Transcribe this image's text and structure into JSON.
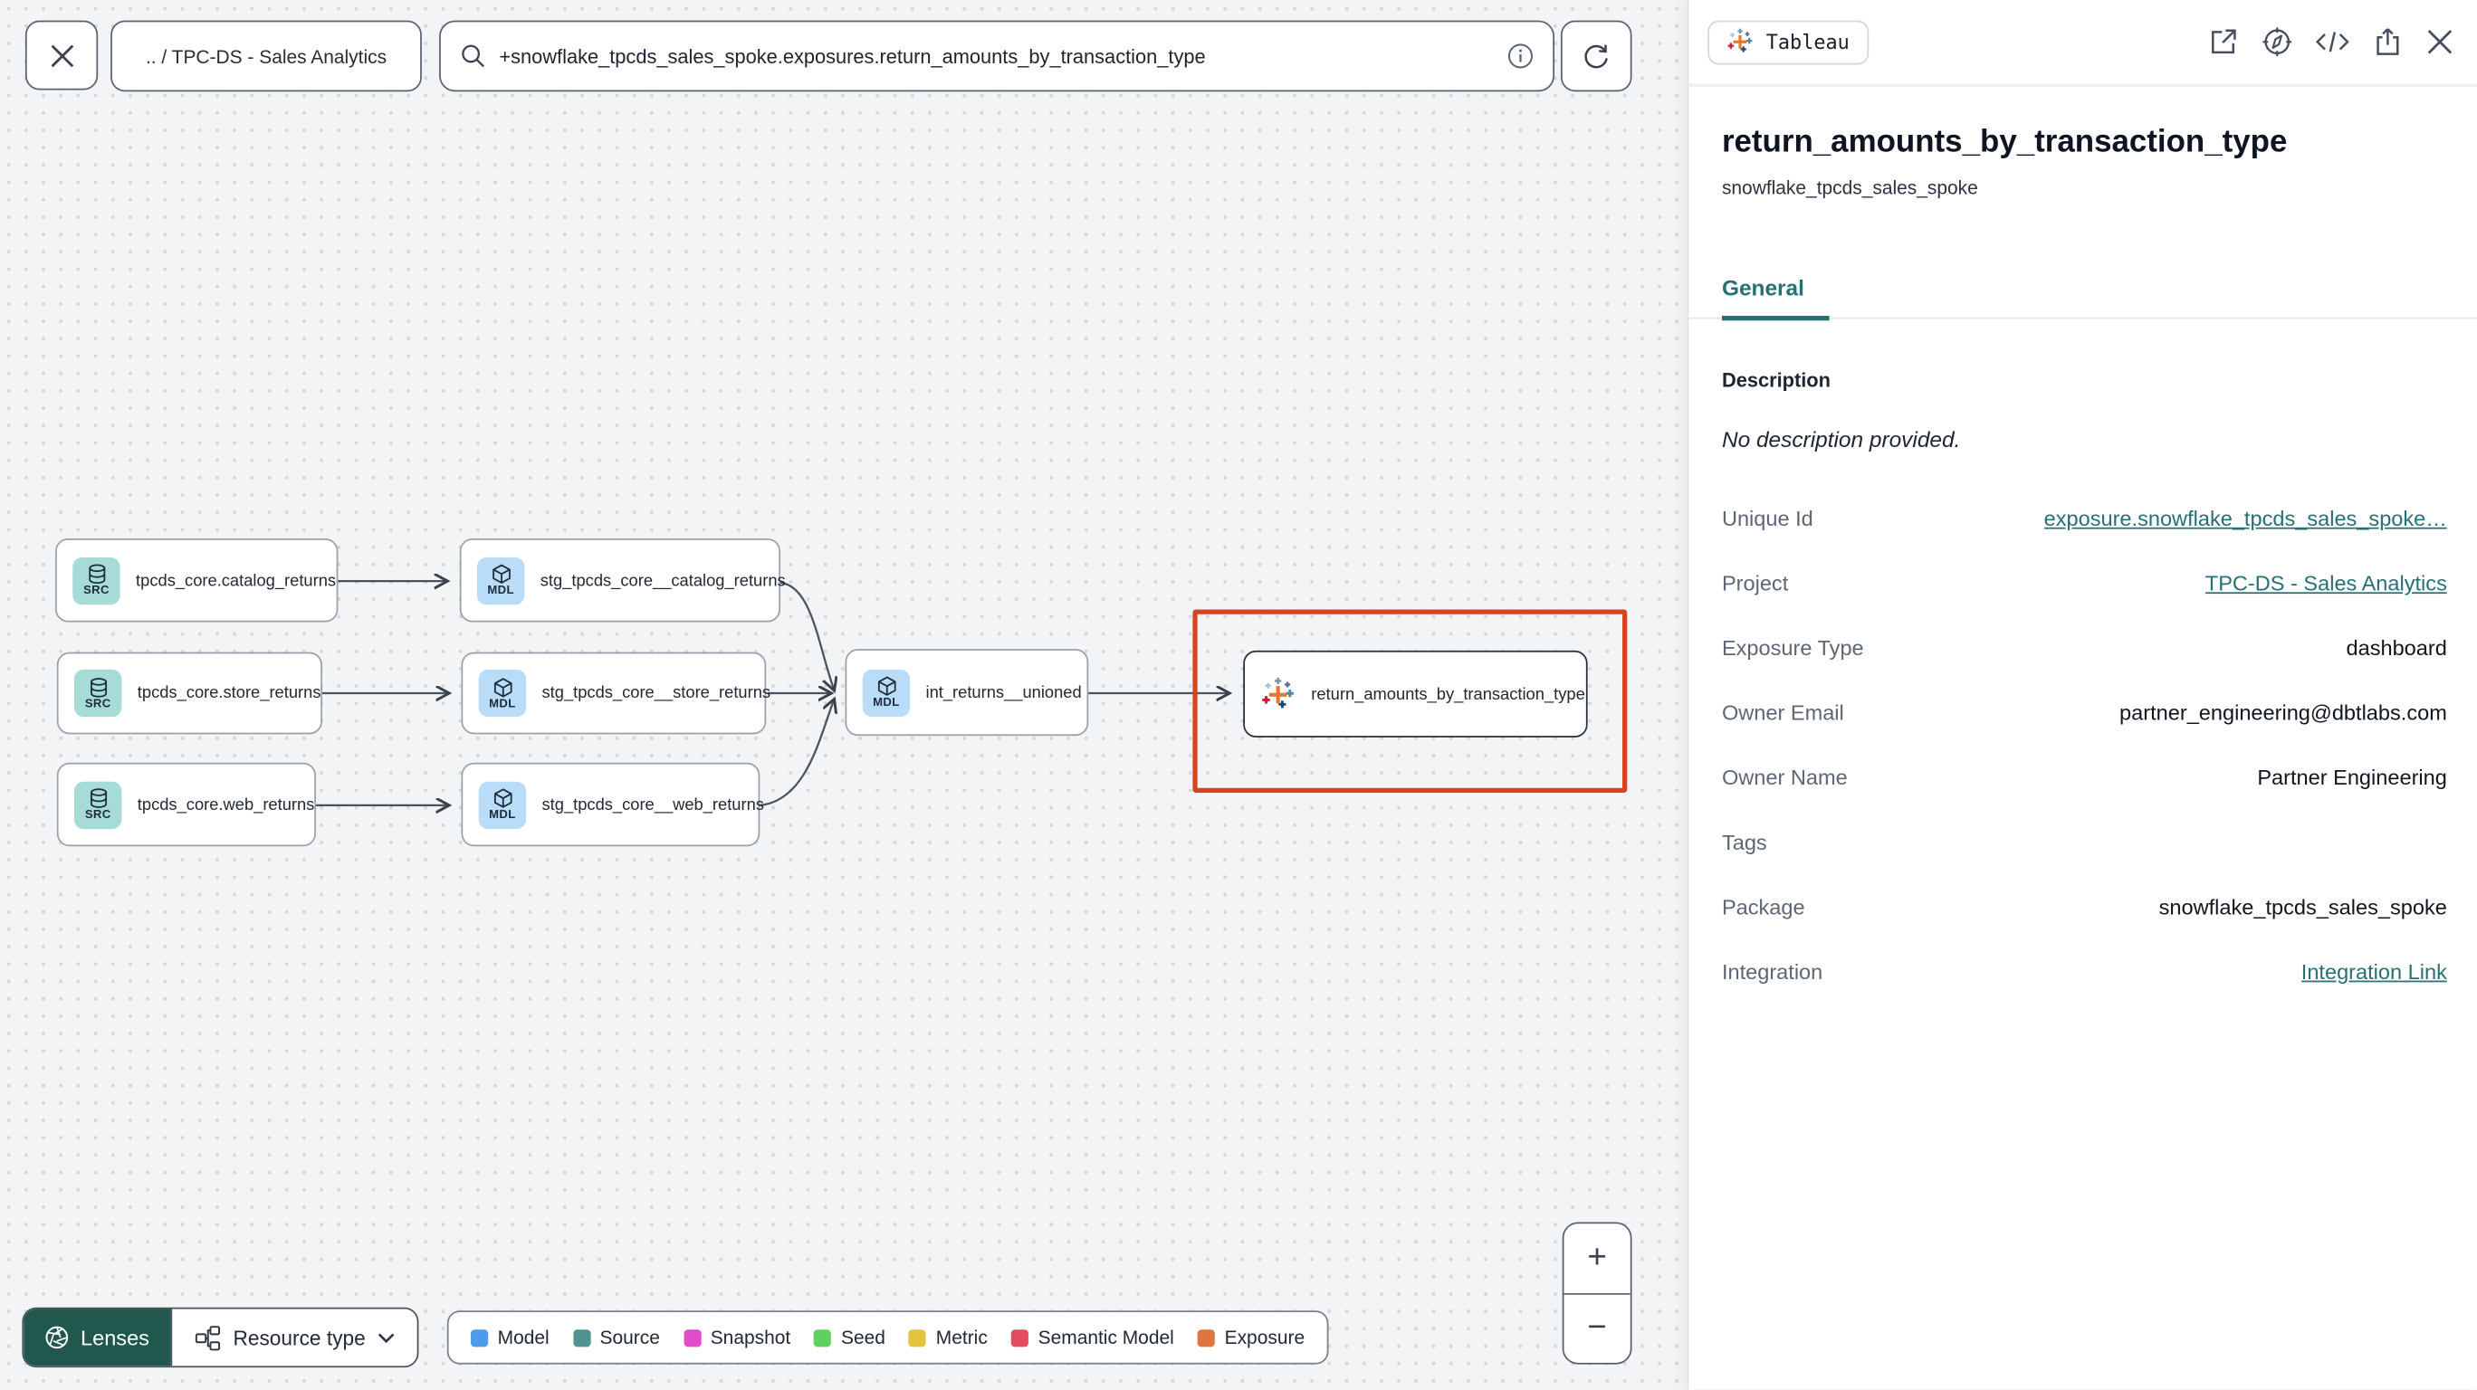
{
  "toolbar": {
    "breadcrumb": ".. / TPC-DS - Sales Analytics",
    "search_value": "+snowflake_tpcds_sales_spoke.exposures.return_amounts_by_transaction_type"
  },
  "graph": {
    "nodes": [
      {
        "type": "SRC",
        "label": "tpcds_core.catalog_returns"
      },
      {
        "type": "SRC",
        "label": "tpcds_core.store_returns"
      },
      {
        "type": "SRC",
        "label": "tpcds_core.web_returns"
      },
      {
        "type": "MDL",
        "label": "stg_tpcds_core__catalog_returns"
      },
      {
        "type": "MDL",
        "label": "stg_tpcds_core__store_returns"
      },
      {
        "type": "MDL",
        "label": "stg_tpcds_core__web_returns"
      },
      {
        "type": "MDL",
        "label": "int_returns__unioned"
      },
      {
        "type": "exposure",
        "label": "return_amounts_by_transaction_type",
        "icon": "tableau-icon"
      }
    ],
    "lenses_label": "Lenses",
    "resource_type_label": "Resource type",
    "zoom_in_label": "+",
    "zoom_out_label": "−",
    "legend": [
      {
        "label": "Model",
        "color": "#4d9ceb"
      },
      {
        "label": "Source",
        "color": "#4f9290"
      },
      {
        "label": "Snapshot",
        "color": "#e24ccb"
      },
      {
        "label": "Seed",
        "color": "#5fd15d"
      },
      {
        "label": "Metric",
        "color": "#e6c33e"
      },
      {
        "label": "Semantic Model",
        "color": "#e74b61"
      },
      {
        "label": "Exposure",
        "color": "#de7641"
      }
    ]
  },
  "panel": {
    "integration_badge": "Tableau",
    "title": "return_amounts_by_transaction_type",
    "subtitle": "snowflake_tpcds_sales_spoke",
    "tab_general": "General",
    "description_label": "Description",
    "description_value": "No description provided.",
    "fields": [
      {
        "label": "Unique Id",
        "value": "exposure.snowflake_tpcds_sales_spoke…",
        "link": true
      },
      {
        "label": "Project",
        "value": "TPC-DS - Sales Analytics",
        "link": true
      },
      {
        "label": "Exposure Type",
        "value": "dashboard",
        "link": false
      },
      {
        "label": "Owner Email",
        "value": "partner_engineering@dbtlabs.com",
        "link": false
      },
      {
        "label": "Owner Name",
        "value": "Partner Engineering",
        "link": false
      },
      {
        "label": "Tags",
        "value": "",
        "link": false
      },
      {
        "label": "Package",
        "value": "snowflake_tpcds_sales_spoke",
        "link": false
      },
      {
        "label": "Integration",
        "value": "Integration Link",
        "link": true
      }
    ]
  },
  "colors": {
    "accent": "#266f75",
    "highlight": "#d5431f",
    "lenses": "#21584e",
    "edge": "#3c4450",
    "src_badge": "#a7dbd8",
    "mdl_badge": "#b9dcf8"
  }
}
